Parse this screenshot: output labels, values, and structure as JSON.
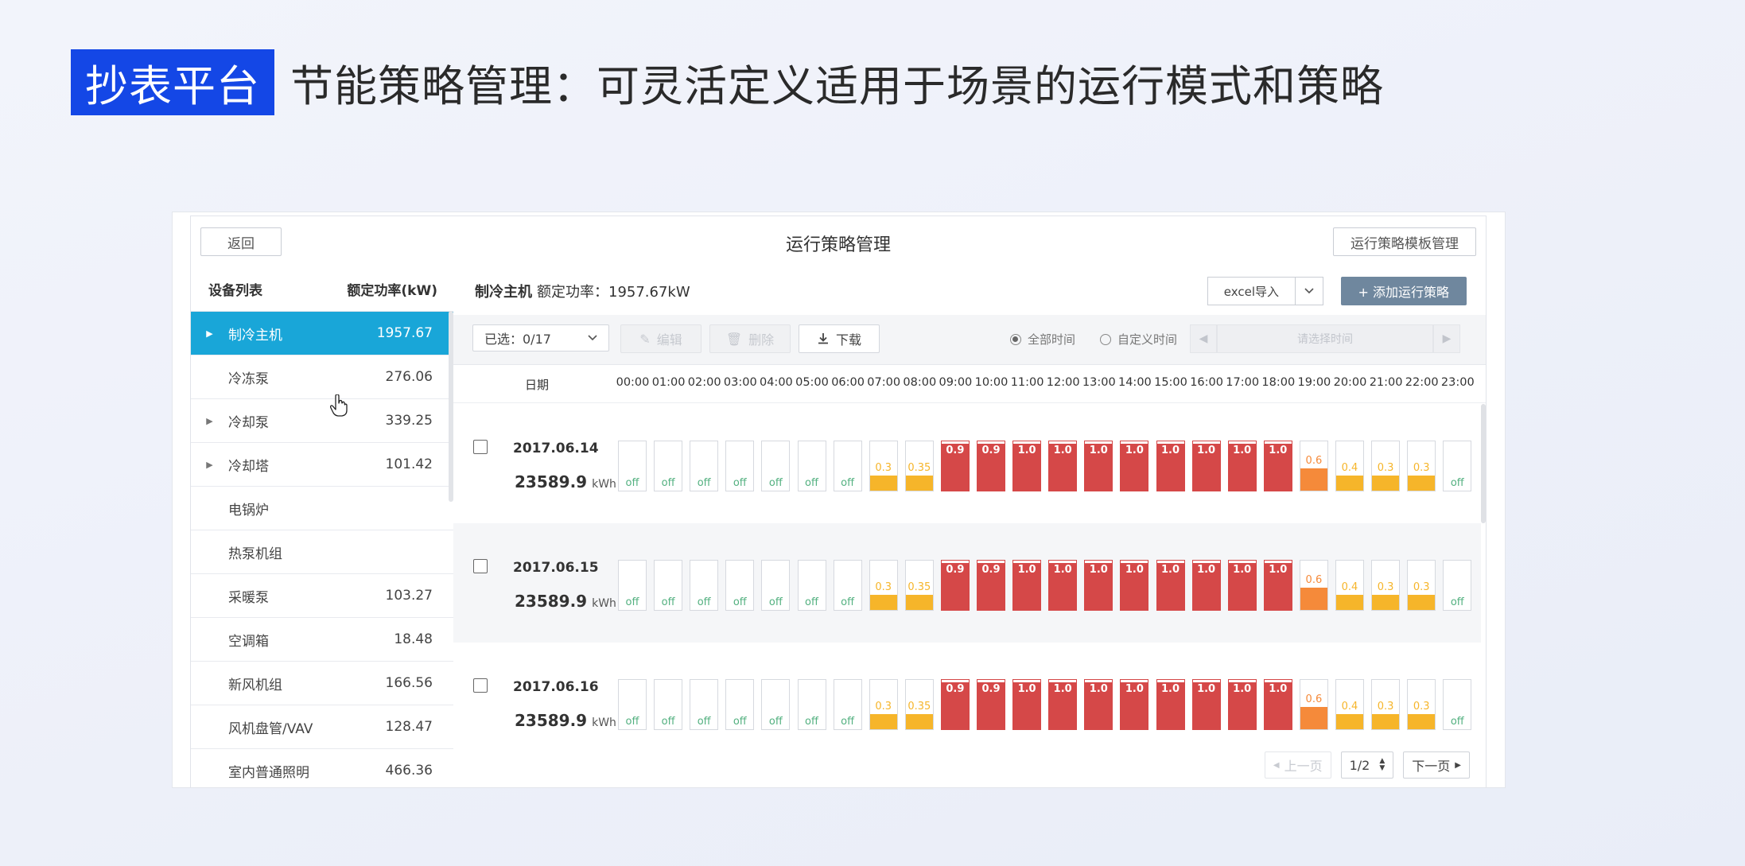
{
  "slide": {
    "badge": "抄表平台",
    "headline": "节能策略管理：可灵活定义适用于场景的运行模式和策略"
  },
  "header": {
    "back_label": "返回",
    "title": "运行策略管理",
    "template_button": "运行策略模板管理"
  },
  "sidebar": {
    "col_device": "设备列表",
    "col_power": "额定功率(kW)",
    "items": [
      {
        "name": "制冷主机",
        "value": "1957.67",
        "expandable": true,
        "active": true
      },
      {
        "name": "冷冻泵",
        "value": "276.06",
        "expandable": false
      },
      {
        "name": "冷却泵",
        "value": "339.25",
        "expandable": true
      },
      {
        "name": "冷却塔",
        "value": "101.42",
        "expandable": true
      },
      {
        "name": "电锅炉",
        "value": "",
        "expandable": false
      },
      {
        "name": "热泵机组",
        "value": "",
        "expandable": false
      },
      {
        "name": "采暖泵",
        "value": "103.27",
        "expandable": false
      },
      {
        "name": "空调箱",
        "value": "18.48",
        "expandable": false
      },
      {
        "name": "新风机组",
        "value": "166.56",
        "expandable": false
      },
      {
        "name": "风机盘管/VAV",
        "value": "128.47",
        "expandable": false
      },
      {
        "name": "室内普通照明",
        "value": "466.36",
        "expandable": false
      }
    ]
  },
  "main": {
    "device_name": "制冷主机",
    "rated_power": "额定功率：1957.67kW",
    "excel_import": "excel导入",
    "add_button": "+ 添加运行策略"
  },
  "toolbar": {
    "selected": "已选：0/17",
    "edit": "编辑",
    "delete": "删除",
    "download": "下载",
    "all_time": "全部时间",
    "custom_time": "自定义时间",
    "time_placeholder": "请选择时间"
  },
  "grid": {
    "date_header": "日期",
    "hours": [
      "00:00",
      "01:00",
      "02:00",
      "03:00",
      "04:00",
      "05:00",
      "06:00",
      "07:00",
      "08:00",
      "09:00",
      "10:00",
      "11:00",
      "12:00",
      "13:00",
      "14:00",
      "15:00",
      "16:00",
      "17:00",
      "18:00",
      "19:00",
      "20:00",
      "21:00",
      "22:00",
      "23:00"
    ],
    "rows": [
      {
        "date": "2017.06.14",
        "energy": "23589.9",
        "unit": "kWh"
      },
      {
        "date": "2017.06.15",
        "energy": "23589.9",
        "unit": "kWh"
      },
      {
        "date": "2017.06.16",
        "energy": "23589.9",
        "unit": "kWh"
      }
    ],
    "levels": [
      "off",
      "off",
      "off",
      "off",
      "off",
      "off",
      "off",
      "0.3",
      "0.35",
      "0.9",
      "0.9",
      "1.0",
      "1.0",
      "1.0",
      "1.0",
      "1.0",
      "1.0",
      "1.0",
      "1.0",
      "0.6",
      "0.4",
      "0.3",
      "0.3",
      "off"
    ],
    "colors": {
      "low": "#f6b52a",
      "mid": "#f58a3a",
      "high": "#d54848",
      "off": "#52b07f"
    }
  },
  "pager": {
    "prev": "上一页",
    "page": "1/2",
    "next": "下一页"
  }
}
